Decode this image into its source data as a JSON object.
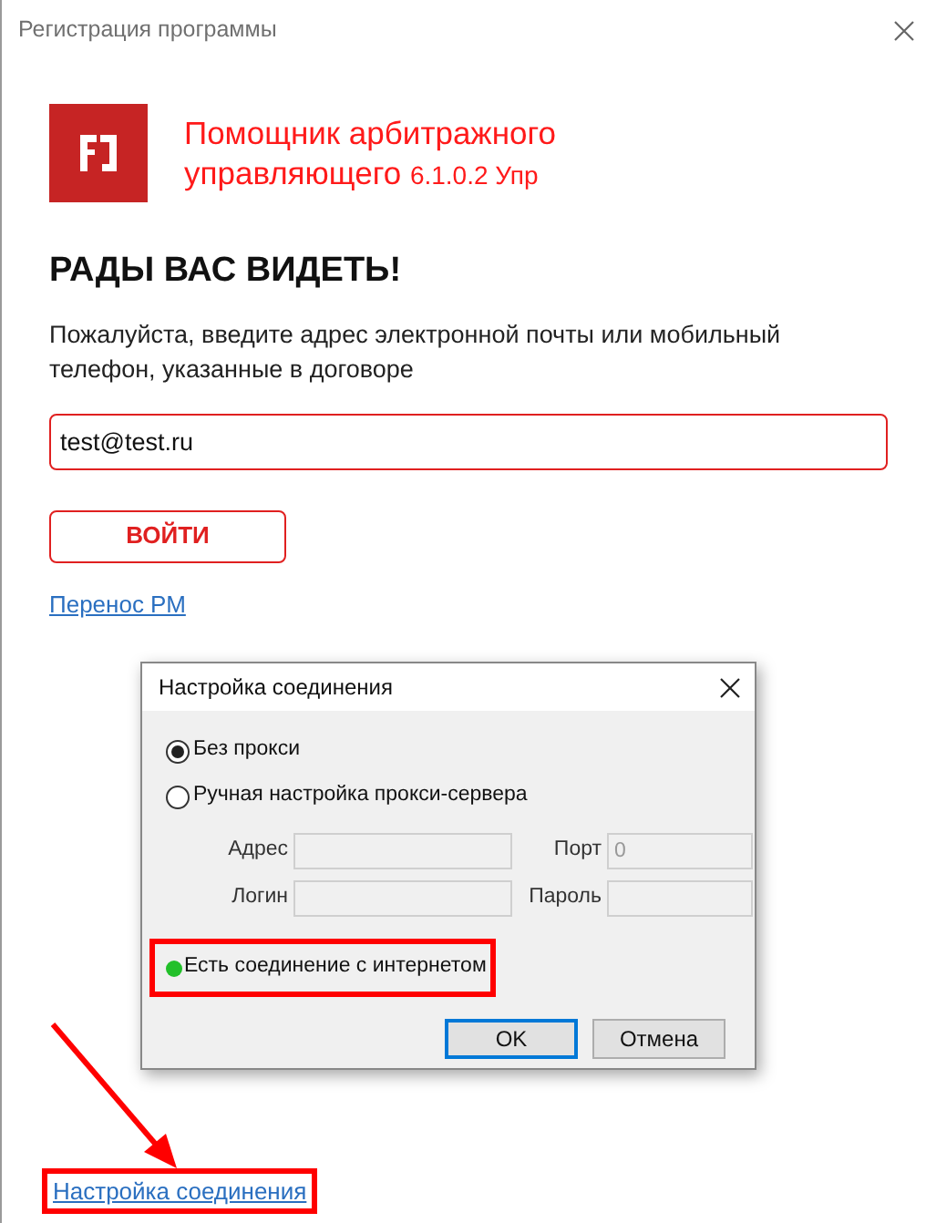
{
  "window": {
    "title": "Регистрация программы"
  },
  "product": {
    "name": "Помощник арбитражного управляющего",
    "version": "6.1.0.2 Упр"
  },
  "heading": "РАДЫ ВАС ВИДЕТЬ!",
  "prompt": "Пожалуйста, введите адрес электронной почты или мобильный телефон, указанные в договоре",
  "login_field": {
    "value": "test@test.ru"
  },
  "login_button": "ВОЙТИ",
  "transfer_link": "Перенос РМ",
  "settings_link": "Настройка соединения",
  "dialog": {
    "title": "Настройка соединения",
    "proxy_options": [
      {
        "label": "Без прокси",
        "selected": true
      },
      {
        "label": "Ручная настройка прокси-сервера",
        "selected": false
      }
    ],
    "fields": [
      {
        "label": "Адрес"
      },
      {
        "label": "Порт",
        "value": "0"
      },
      {
        "label": "Логин"
      },
      {
        "label": "Пароль"
      }
    ],
    "status": {
      "text": "Есть соединение с интернетом",
      "color": "#22c02a"
    },
    "buttons": [
      {
        "label": "OK",
        "default": true
      },
      {
        "label": "Отмена",
        "default": false
      }
    ]
  }
}
